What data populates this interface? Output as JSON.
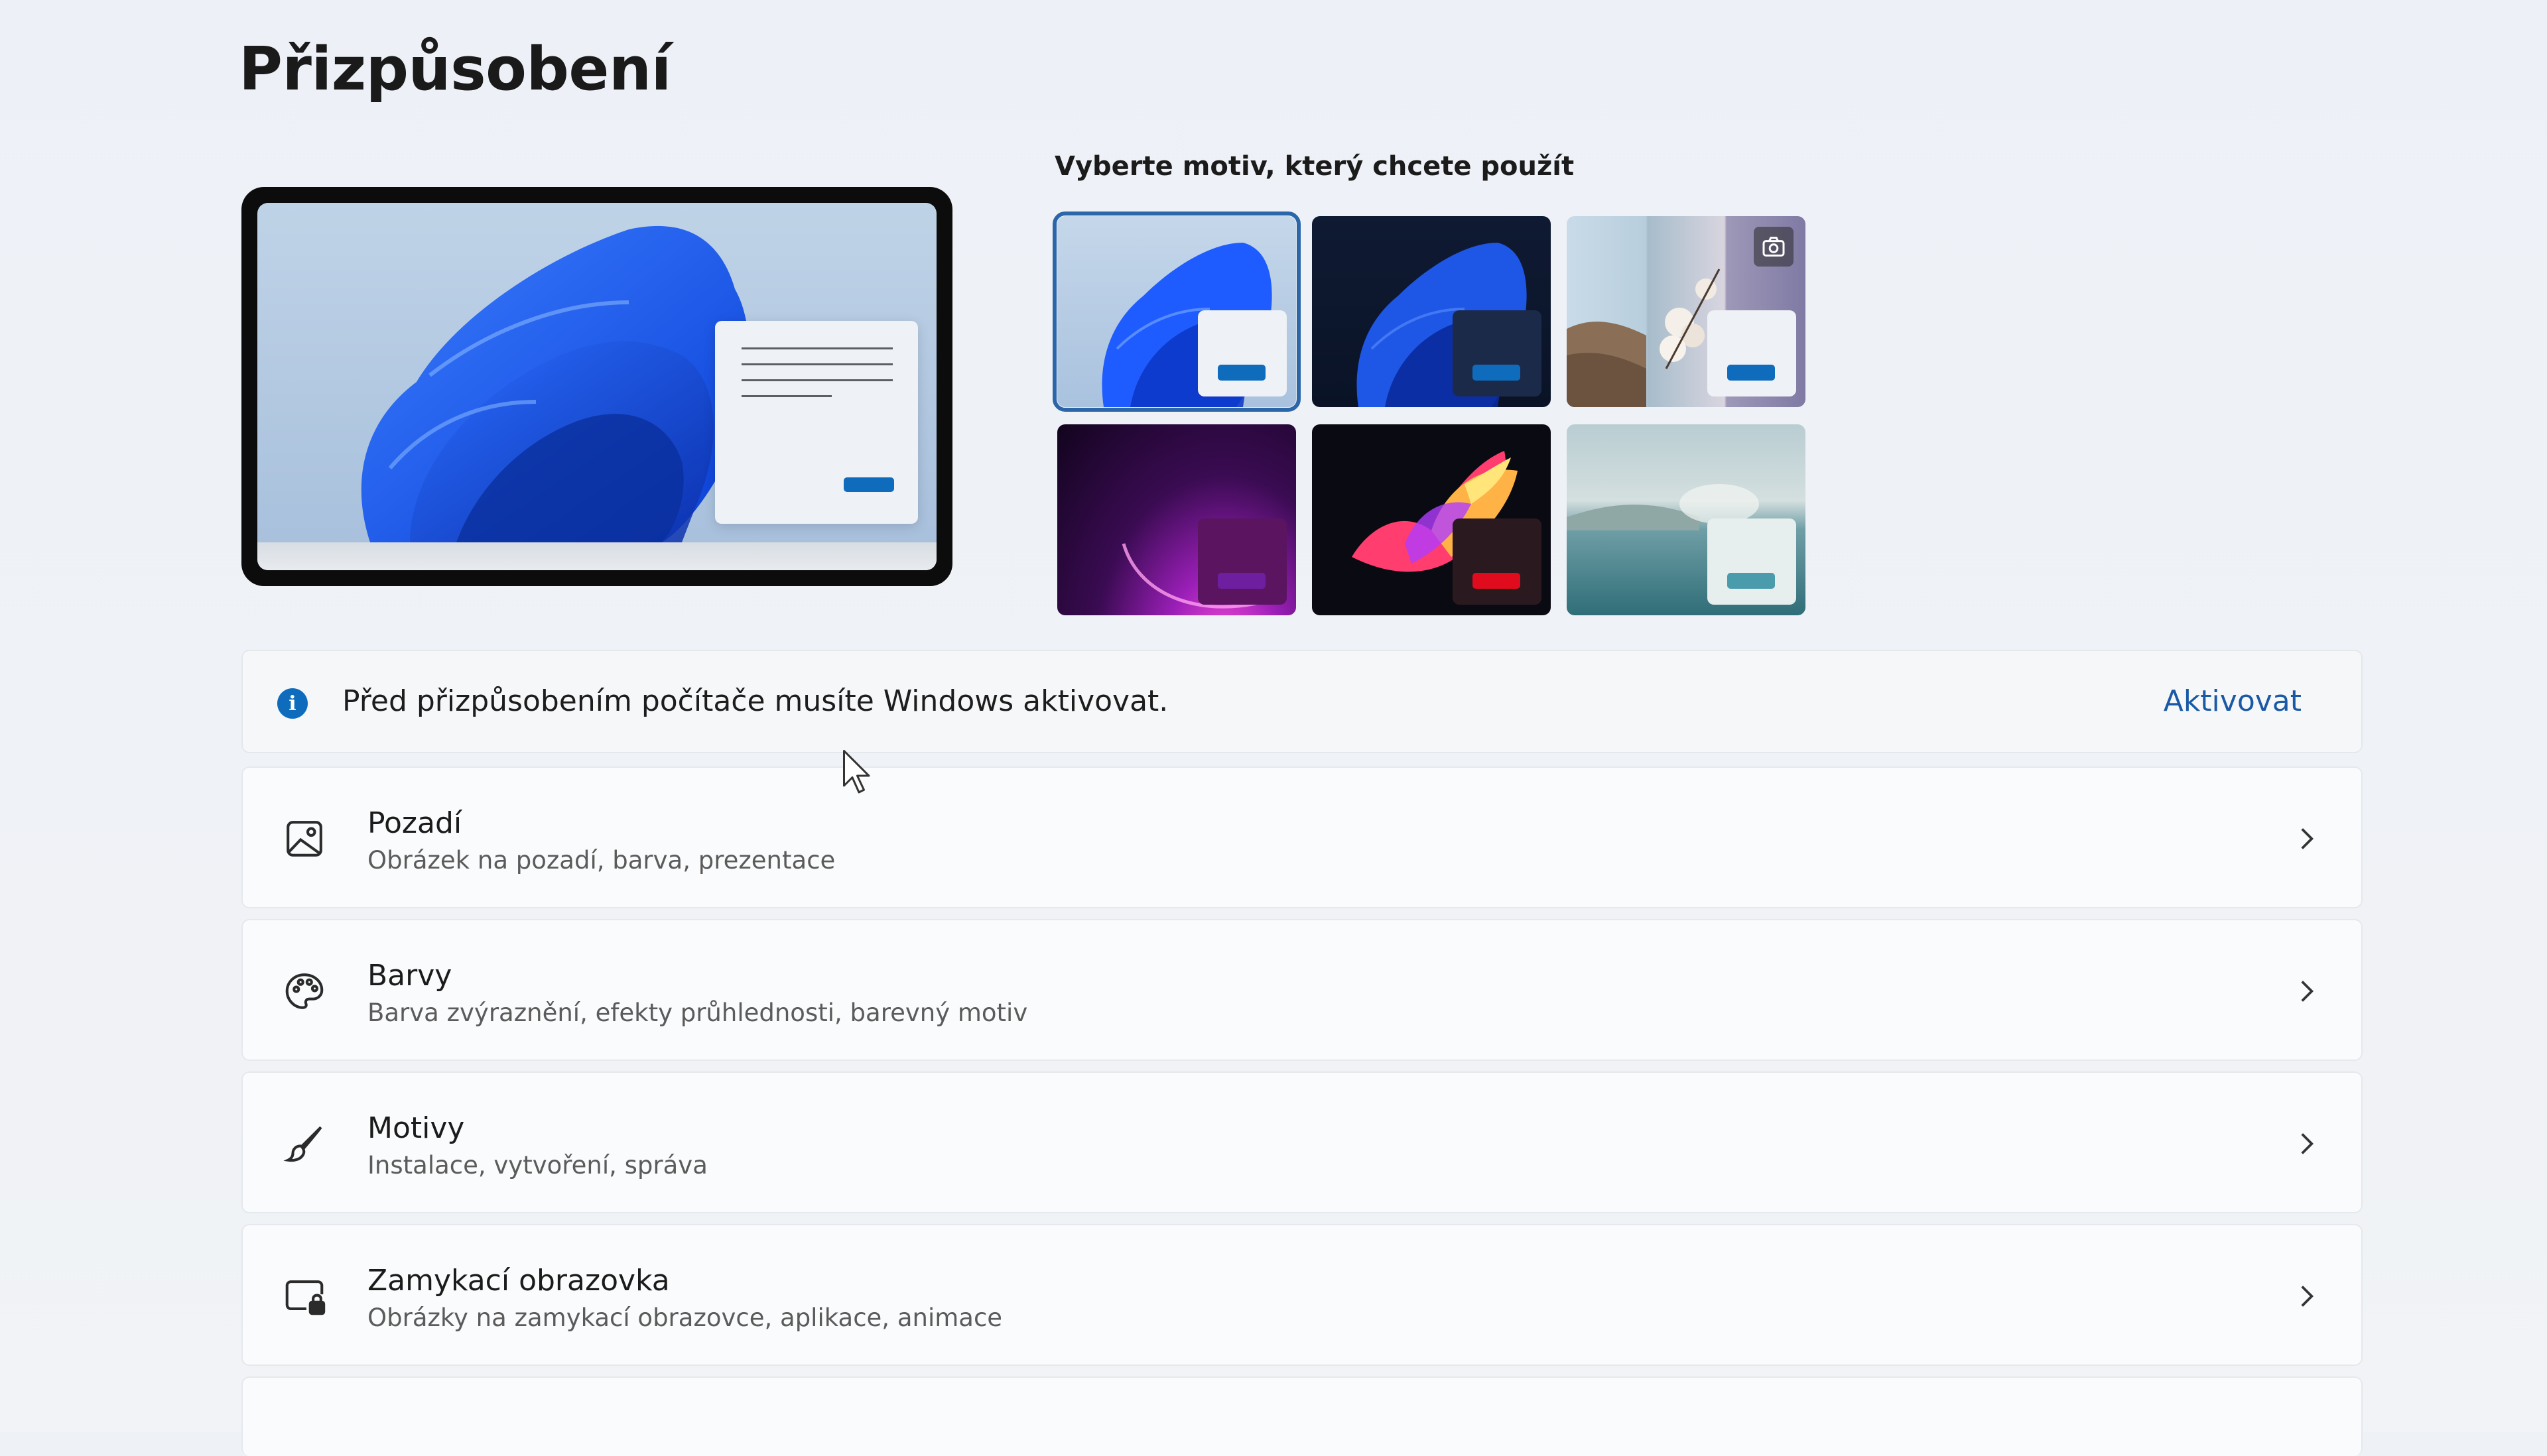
{
  "page": {
    "title": "Přizpůsobení"
  },
  "themes": {
    "label": "Vyberte motiv, který chcete použít",
    "items": [
      {
        "id": "windows-light",
        "selected": true,
        "accent": "#0f6cbd"
      },
      {
        "id": "windows-dark",
        "selected": false,
        "accent": "#0f6cbd"
      },
      {
        "id": "captured-motion",
        "selected": false,
        "accent": "#0f6cbd"
      },
      {
        "id": "glow",
        "selected": false,
        "accent": "#5c1d7a"
      },
      {
        "id": "flow",
        "selected": false,
        "accent": "#e00b1c"
      },
      {
        "id": "sunrise",
        "selected": false,
        "accent": "#4a9bab"
      }
    ]
  },
  "info_bar": {
    "text": "Před přizpůsobením počítače musíte Windows aktivovat.",
    "action": "Aktivovat",
    "icon": "info-icon"
  },
  "settings": [
    {
      "id": "background",
      "title": "Pozadí",
      "subtitle": "Obrázek na pozadí, barva, prezentace",
      "icon": "image-icon"
    },
    {
      "id": "colors",
      "title": "Barvy",
      "subtitle": "Barva zvýraznění, efekty průhlednosti, barevný motiv",
      "icon": "palette-icon"
    },
    {
      "id": "themes",
      "title": "Motivy",
      "subtitle": "Instalace, vytvoření, správa",
      "icon": "brush-icon"
    },
    {
      "id": "lockscreen",
      "title": "Zamykací obrazovka",
      "subtitle": "Obrázky na zamykací obrazovce, aplikace, animace",
      "icon": "lock-screen-icon"
    }
  ],
  "colors": {
    "accent": "#0f6cbd",
    "link": "#1a5aa5",
    "selected_outline": "#2b66a8"
  }
}
